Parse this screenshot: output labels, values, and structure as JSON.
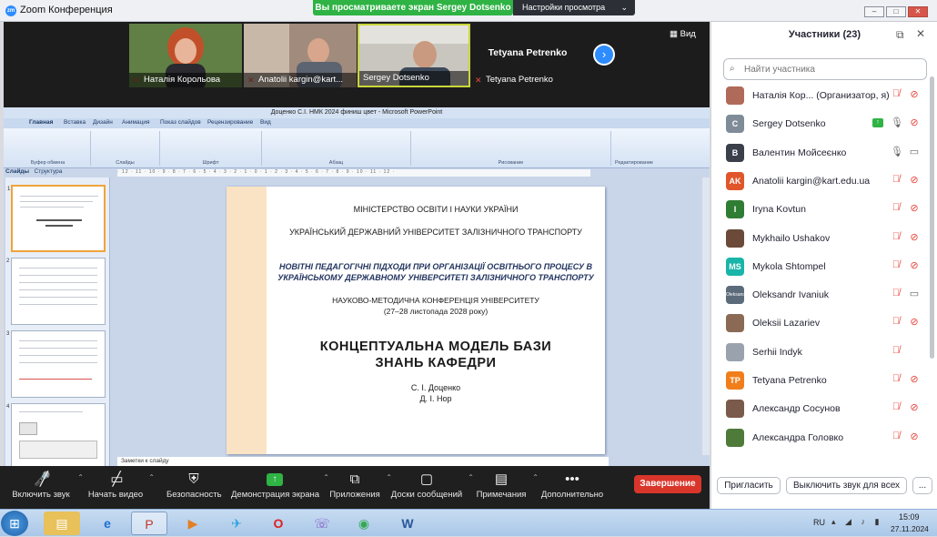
{
  "window": {
    "app_title": "Zoom Конференция",
    "share_banner": "Вы просматриваете экран Sergey Dotsenko",
    "view_settings": "Настройки просмотра"
  },
  "gallery": {
    "view_label": "Вид",
    "tiles": [
      {
        "name": "Наталія Корольова"
      },
      {
        "name": "Anatolii kargin@kart..."
      },
      {
        "name": "Sergey Dotsenko"
      },
      {
        "name": "Tetyana Petrenko",
        "title": "Tetyana Petrenko"
      }
    ]
  },
  "ppt": {
    "title": "Доценко С.І. НМК 2024 финиш цвет  -  Microsoft PowerPoint",
    "tabs": [
      "Главная",
      "Вставка",
      "Дизайн",
      "Анимация",
      "Показ слайдов",
      "Рецензирование",
      "Вид"
    ],
    "groups": [
      "Буфер обмена",
      "Слайды",
      "Шрифт",
      "Абзац",
      "Рисование",
      "Редактирование"
    ],
    "pane_tabs": [
      "Слайды",
      "Структура"
    ],
    "notes": "Заметки к слайду",
    "slide": {
      "line1": "МІНІСТЕРСТВО ОСВІТИ І НАУКИ УКРАЇНИ",
      "line2": "УКРАЇНСЬКИЙ ДЕРЖАВНИЙ УНІВЕРСИТЕТ ЗАЛІЗНИЧНОГО ТРАНСПОРТУ",
      "line3": "НОВІТНІ ПЕДАГОГІЧНІ ПІДХОДИ ПРИ ОРГАНІЗАЦІЇ ОСВІТНЬОГО ПРОЦЕСУ В УКРАЇНСЬКОМУ ДЕРЖАВНОМУ УНІВЕРСИТЕТІ ЗАЛІЗНИЧНОГО ТРАНСПОРТУ",
      "line4": "НАУКОВО-МЕТОДИЧНА КОНФЕРЕНЦІЯ УНІВЕРСИТЕТУ",
      "line5": "(27–28 листопада 2028 року)",
      "title1": "КОНЦЕПТУАЛЬНА МОДЕЛЬ БАЗИ",
      "title2": "ЗНАНЬ КАФЕДРИ",
      "author1": "С. І. Доценко",
      "author2": "Д. І. Нор"
    }
  },
  "toolbar": {
    "mute": "Включить звук",
    "video": "Начать видео",
    "security": "Безопасность",
    "share": "Демонстрация экрана",
    "apps": "Приложения",
    "chat": "Доски сообщений",
    "notes": "Примечания",
    "more": "Дополнительно",
    "end": "Завершение"
  },
  "participants": {
    "header": "Участники (23)",
    "search_placeholder": "Найти участника",
    "list": [
      {
        "name": "Наталія Кор...  (Организатор, я)",
        "avatar": "",
        "color": "#b06a5a",
        "mic": "off",
        "cam": "off"
      },
      {
        "name": "Sergey Dotsenko",
        "avatar": "C",
        "color": "#7f8c98",
        "mic": "on",
        "cam": "off",
        "sharing": true
      },
      {
        "name": "Валентин Мойсеєнко",
        "avatar": "B",
        "color": "#3a3f4a",
        "mic": "on",
        "cam": "on"
      },
      {
        "name": "Anatolii kargin@kart.edu.ua",
        "avatar": "AK",
        "color": "#e0562a",
        "mic": "off",
        "cam": "off"
      },
      {
        "name": "Iryna Kovtun",
        "avatar": "I",
        "color": "#2e7d32",
        "mic": "off",
        "cam": "off"
      },
      {
        "name": "Mykhailo Ushakov",
        "avatar": "",
        "color": "#6b4a3a",
        "mic": "off",
        "cam": "off"
      },
      {
        "name": "Mykola Shtompel",
        "avatar": "MS",
        "color": "#19b5a8",
        "mic": "off",
        "cam": "off"
      },
      {
        "name": "Oleksandr Ivaniuk",
        "avatar": "Oleksand",
        "color": "#5b6b7a",
        "mic": "off",
        "cam": "on"
      },
      {
        "name": "Oleksii Lazariev",
        "avatar": "",
        "color": "#8a6a55",
        "mic": "off",
        "cam": "off"
      },
      {
        "name": "Serhii Indyk",
        "avatar": "",
        "color": "#9aa3ad",
        "mic": "off",
        "cam": ""
      },
      {
        "name": "Tetyana Petrenko",
        "avatar": "TP",
        "color": "#f07e1b",
        "mic": "off",
        "cam": "off"
      },
      {
        "name": "Александр Сосунов",
        "avatar": "",
        "color": "#7a5a4a",
        "mic": "off",
        "cam": "off"
      },
      {
        "name": "Александра Головко",
        "avatar": "",
        "color": "#4e7a3a",
        "mic": "off",
        "cam": "off"
      }
    ],
    "invite": "Пригласить",
    "mute_all": "Выключить звук для всех",
    "more": "..."
  },
  "taskbar": {
    "lang": "RU",
    "time": "15:09",
    "date": "27.11.2024"
  }
}
